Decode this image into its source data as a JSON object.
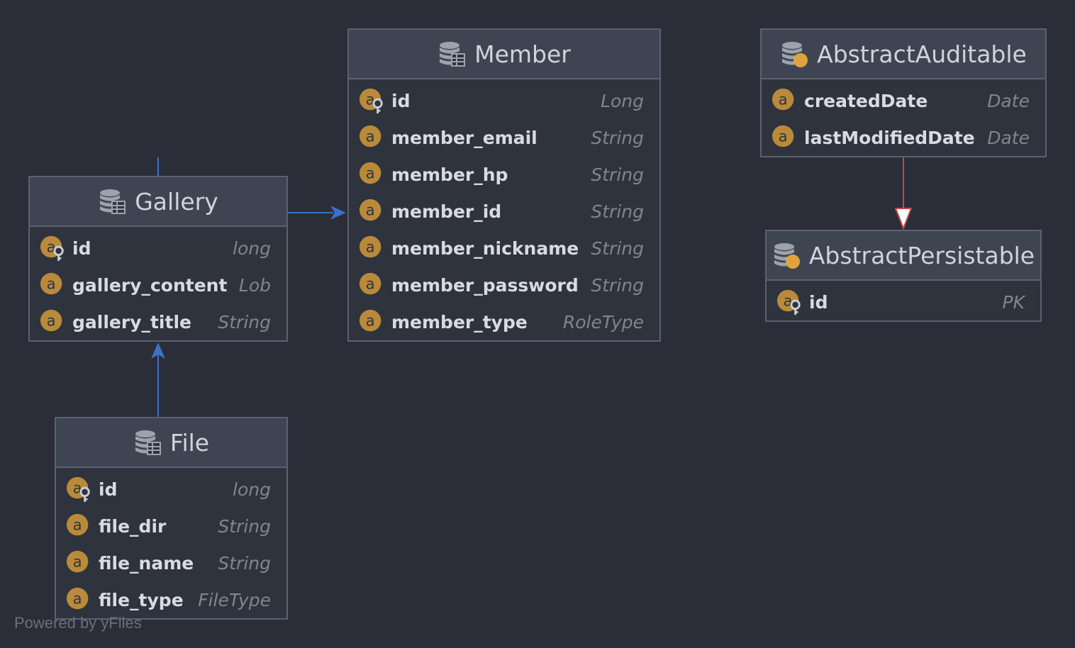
{
  "colors": {
    "background": "#2b2d38",
    "header": "#3e4452",
    "field_icon": "#b98a3a",
    "association_arrow": "#3a73c6",
    "inheritance_arrow": "#c24848"
  },
  "entities": {
    "gallery": {
      "title": "Gallery",
      "fields": [
        {
          "name": "id",
          "type": "long",
          "key": true
        },
        {
          "name": "gallery_content",
          "type": "Lob",
          "key": false
        },
        {
          "name": "gallery_title",
          "type": "String",
          "key": false
        }
      ]
    },
    "member": {
      "title": "Member",
      "fields": [
        {
          "name": "id",
          "type": "Long",
          "key": true
        },
        {
          "name": "member_email",
          "type": "String",
          "key": false
        },
        {
          "name": "member_hp",
          "type": "String",
          "key": false
        },
        {
          "name": "member_id",
          "type": "String",
          "key": false
        },
        {
          "name": "member_nickname",
          "type": "String",
          "key": false
        },
        {
          "name": "member_password",
          "type": "String",
          "key": false
        },
        {
          "name": "member_type",
          "type": "RoleType",
          "key": false
        }
      ]
    },
    "abstract_auditable": {
      "title": "AbstractAuditable",
      "fields": [
        {
          "name": "createdDate",
          "type": "Date",
          "key": false
        },
        {
          "name": "lastModifiedDate",
          "type": "Date",
          "key": false
        }
      ]
    },
    "abstract_persistable": {
      "title": "AbstractPersistable",
      "fields": [
        {
          "name": "id",
          "type": "PK",
          "key": true
        }
      ]
    },
    "file": {
      "title": "File",
      "fields": [
        {
          "name": "id",
          "type": "long",
          "key": true
        },
        {
          "name": "file_dir",
          "type": "String",
          "key": false
        },
        {
          "name": "file_name",
          "type": "String",
          "key": false
        },
        {
          "name": "file_type",
          "type": "FileType",
          "key": false
        }
      ]
    }
  },
  "footer": "Powered by yFiles"
}
